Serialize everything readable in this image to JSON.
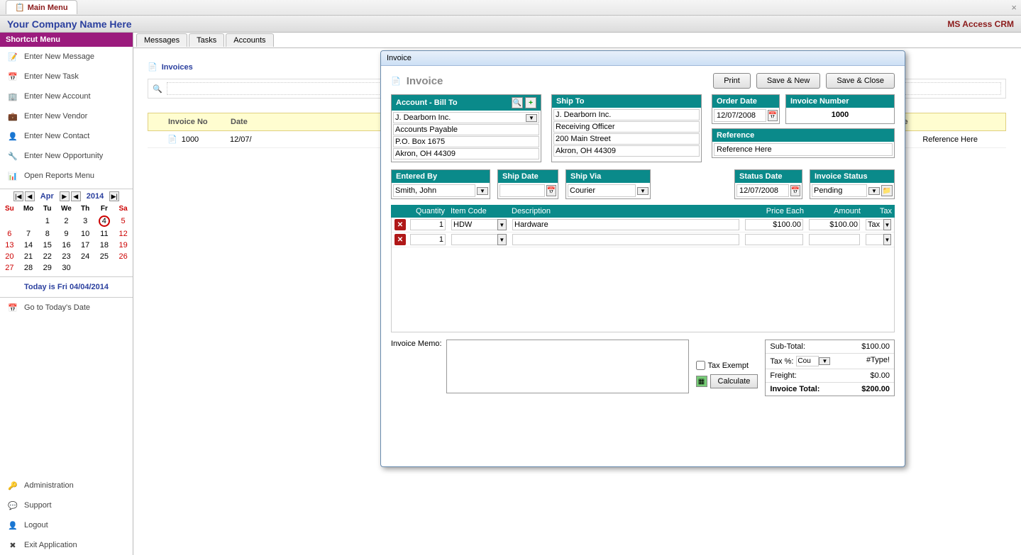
{
  "mainTab": "Main Menu",
  "header": {
    "company": "Your Company Name Here",
    "app": "MS Access CRM"
  },
  "sidebar": {
    "title": "Shortcut Menu",
    "items": [
      "Enter New Message",
      "Enter New Task",
      "Enter New Account",
      "Enter New Vendor",
      "Enter New Contact",
      "Enter New Opportunity",
      "Open Reports Menu"
    ],
    "todayLine": "Today is Fri 04/04/2014",
    "goToday": "Go to Today's Date",
    "bottom": [
      "Administration",
      "Support",
      "Logout",
      "Exit Application"
    ]
  },
  "calendar": {
    "month": "Apr",
    "year": "2014",
    "dow": [
      "Su",
      "Mo",
      "Tu",
      "We",
      "Th",
      "Fr",
      "Sa"
    ],
    "weeks": [
      [
        "",
        "",
        "1",
        "2",
        "3",
        "4",
        "5"
      ],
      [
        "6",
        "7",
        "8",
        "9",
        "10",
        "11",
        "12"
      ],
      [
        "13",
        "14",
        "15",
        "16",
        "17",
        "18",
        "19"
      ],
      [
        "20",
        "21",
        "22",
        "23",
        "24",
        "25",
        "26"
      ],
      [
        "27",
        "28",
        "29",
        "30",
        "",
        "",
        ""
      ]
    ],
    "todayCell": "4"
  },
  "tabs": [
    "Messages",
    "Tasks",
    "Accounts"
  ],
  "list": {
    "title": "Invoices",
    "headers": {
      "no": "Invoice No",
      "date": "Date",
      "ref": "Reference"
    },
    "rows": [
      {
        "no": "1000",
        "date": "12/07/",
        "ref": "Reference Here"
      }
    ]
  },
  "modal": {
    "windowTitle": "Invoice",
    "title": "Invoice",
    "buttons": {
      "print": "Print",
      "saveNew": "Save & New",
      "saveClose": "Save & Close"
    },
    "billTo": {
      "label": "Account - Bill To",
      "name": "J. Dearborn Inc.",
      "l2": "Accounts Payable",
      "l3": "P.O. Box 1675",
      "l4": "Akron, OH  44309"
    },
    "shipTo": {
      "label": "Ship To",
      "name": "J. Dearborn Inc.",
      "l2": "Receiving Officer",
      "l3": "200 Main Street",
      "l4": "Akron, OH  44309"
    },
    "orderDate": {
      "label": "Order Date",
      "value": "12/07/2008"
    },
    "invoiceNumber": {
      "label": "Invoice Number",
      "value": "1000"
    },
    "reference": {
      "label": "Reference",
      "value": "Reference Here"
    },
    "enteredBy": {
      "label": "Entered By",
      "value": "Smith, John"
    },
    "shipDate": {
      "label": "Ship Date",
      "value": ""
    },
    "shipVia": {
      "label": "Ship Via",
      "value": "Courier"
    },
    "statusDate": {
      "label": "Status Date",
      "value": "12/07/2008"
    },
    "invoiceStatus": {
      "label": "Invoice Status",
      "value": "Pending"
    },
    "lineHeaders": {
      "qty": "Quantity",
      "code": "Item Code",
      "desc": "Description",
      "price": "Price Each",
      "amount": "Amount",
      "tax": "Tax"
    },
    "lines": [
      {
        "qty": "1",
        "code": "HDW",
        "desc": "Hardware",
        "price": "$100.00",
        "amount": "$100.00",
        "tax": "Tax"
      },
      {
        "qty": "1",
        "code": "",
        "desc": "",
        "price": "",
        "amount": "",
        "tax": ""
      }
    ],
    "memoLabel": "Invoice Memo:",
    "taxExempt": "Tax Exempt",
    "calculate": "Calculate",
    "totals": {
      "subLabel": "Sub-Total:",
      "subValue": "$100.00",
      "taxLabel": "Tax %:",
      "taxCombo": "Cou",
      "taxValue": "#Type!",
      "freightLabel": "Freight:",
      "freightValue": "$0.00",
      "totalLabel": "Invoice Total:",
      "totalValue": "$200.00"
    }
  }
}
